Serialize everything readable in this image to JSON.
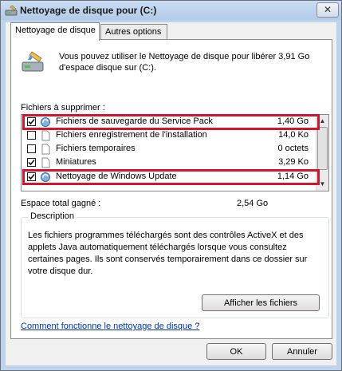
{
  "window": {
    "title": "Nettoyage de disque pour  (C:)",
    "close_glyph": "✕"
  },
  "tabs": [
    {
      "label": "Nettoyage de disque",
      "active": true
    },
    {
      "label": "Autres options",
      "active": false
    }
  ],
  "intro": {
    "text": "Vous pouvez utiliser le Nettoyage de disque pour libérer 3,91 Go d'espace disque sur  (C:)."
  },
  "files_section": {
    "label": "Fichiers à supprimer :",
    "items": [
      {
        "name": "Fichiers de sauvegarde du Service Pack",
        "size": "1,40 Go",
        "checked": true,
        "icon": "recycle-icon",
        "highlighted": true
      },
      {
        "name": "Fichiers enregistrement de l'installation",
        "size": "14,0 Ko",
        "checked": false,
        "icon": "file-icon",
        "highlighted": false
      },
      {
        "name": "Fichiers temporaires",
        "size": "0 octets",
        "checked": false,
        "icon": "file-icon",
        "highlighted": false
      },
      {
        "name": "Miniatures",
        "size": "3,29 Ko",
        "checked": true,
        "icon": "file-icon",
        "highlighted": false
      },
      {
        "name": "Nettoyage de Windows Update",
        "size": "1,14 Go",
        "checked": true,
        "icon": "recycle-icon",
        "highlighted": true
      }
    ],
    "highlight_color": "#d0162c"
  },
  "total": {
    "label": "Espace total gagné :",
    "value": "2,54 Go"
  },
  "description": {
    "title": "Description",
    "text": "Les fichiers programmes téléchargés sont des contrôles ActiveX et des applets Java automatiquement téléchargés lorsque vous consultez certaines pages. Ils sont conservés temporairement dans ce dossier sur votre disque dur.",
    "view_files_button": "Afficher les fichiers"
  },
  "help_link": "Comment fonctionne le nettoyage de disque ?",
  "footer": {
    "ok": "OK",
    "cancel": "Annuler"
  }
}
